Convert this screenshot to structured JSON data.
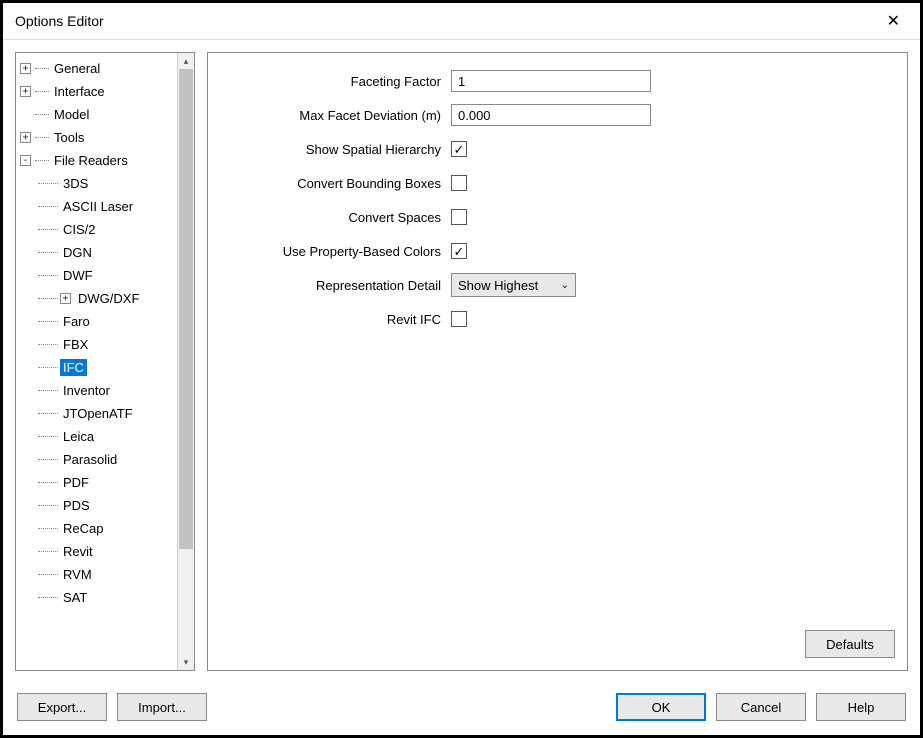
{
  "window": {
    "title": "Options Editor"
  },
  "tree": {
    "items": [
      {
        "label": "General",
        "exp": "+",
        "level": 0
      },
      {
        "label": "Interface",
        "exp": "+",
        "level": 0
      },
      {
        "label": "Model",
        "exp": "",
        "level": 0
      },
      {
        "label": "Tools",
        "exp": "+",
        "level": 0
      },
      {
        "label": "File Readers",
        "exp": "-",
        "level": 0
      },
      {
        "label": "3DS",
        "exp": "",
        "level": 1
      },
      {
        "label": "ASCII Laser",
        "exp": "",
        "level": 1
      },
      {
        "label": "CIS/2",
        "exp": "",
        "level": 1
      },
      {
        "label": "DGN",
        "exp": "",
        "level": 1
      },
      {
        "label": "DWF",
        "exp": "",
        "level": 1
      },
      {
        "label": "DWG/DXF",
        "exp": "+",
        "level": 1
      },
      {
        "label": "Faro",
        "exp": "",
        "level": 1
      },
      {
        "label": "FBX",
        "exp": "",
        "level": 1
      },
      {
        "label": "IFC",
        "exp": "",
        "level": 1,
        "selected": true
      },
      {
        "label": "Inventor",
        "exp": "",
        "level": 1
      },
      {
        "label": "JTOpenATF",
        "exp": "",
        "level": 1
      },
      {
        "label": "Leica",
        "exp": "",
        "level": 1
      },
      {
        "label": "Parasolid",
        "exp": "",
        "level": 1
      },
      {
        "label": "PDF",
        "exp": "",
        "level": 1
      },
      {
        "label": "PDS",
        "exp": "",
        "level": 1
      },
      {
        "label": "ReCap",
        "exp": "",
        "level": 1
      },
      {
        "label": "Revit",
        "exp": "",
        "level": 1
      },
      {
        "label": "RVM",
        "exp": "",
        "level": 1
      },
      {
        "label": "SAT",
        "exp": "",
        "level": 1
      }
    ]
  },
  "form": {
    "faceting_factor": {
      "label": "Faceting Factor",
      "value": "1"
    },
    "max_facet_deviation": {
      "label": "Max Facet Deviation (m)",
      "value": "0.000"
    },
    "show_spatial_hierarchy": {
      "label": "Show Spatial Hierarchy",
      "checked": true
    },
    "convert_bounding_boxes": {
      "label": "Convert Bounding Boxes",
      "checked": false
    },
    "convert_spaces": {
      "label": "Convert Spaces",
      "checked": false
    },
    "use_property_colors": {
      "label": "Use Property-Based Colors",
      "checked": true
    },
    "representation_detail": {
      "label": "Representation Detail",
      "value": "Show Highest"
    },
    "revit_ifc": {
      "label": "Revit IFC",
      "checked": false
    }
  },
  "buttons": {
    "defaults": "Defaults",
    "export": "Export...",
    "import": "Import...",
    "ok": "OK",
    "cancel": "Cancel",
    "help": "Help"
  }
}
